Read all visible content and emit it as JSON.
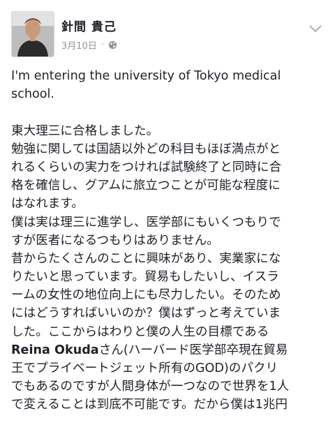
{
  "post": {
    "author": "針間 貴己",
    "date": "3月10日",
    "separator": "·",
    "english_line1": "I'm entering the university of Tokyo medical",
    "english_line2": "school.",
    "jp_lines": [
      "東大理三に合格しました。",
      "勉強に関しては国語以外どの科目もほぼ満点がと",
      "れるくらいの実力をつければ試験終了と同時に合",
      "格を確信し、グアムに旅立つことが可能な程度に",
      "はなれます。",
      "僕は実は理三に進学し、医学部にもいくつもりで",
      "すが医者になるつもりはありません。",
      "昔からたくさんのことに興味があり、実業家にな",
      "りたいと思っています。貿易もしたいし、イスラ",
      "ームの女性の地位向上にも尽力したい。そのため",
      "にはどうすればいいのか？僕はずっと考えていま",
      "した。ここからはわりと僕の人生の目標である"
    ],
    "reina_name": "Reina Okuda",
    "reina_rest": "さん(ハーバード医学部卒現在貿易",
    "jp_lines_after": [
      "王でプライベートジェット所有のGOD)のパクリ",
      "でもあるのですが人間身体が一つなので世界を1人",
      "で変えることは到底不可能です。だから僕は1兆円"
    ]
  },
  "icons": {
    "globe": "globe-icon",
    "chevron": "chevron-down-icon"
  }
}
